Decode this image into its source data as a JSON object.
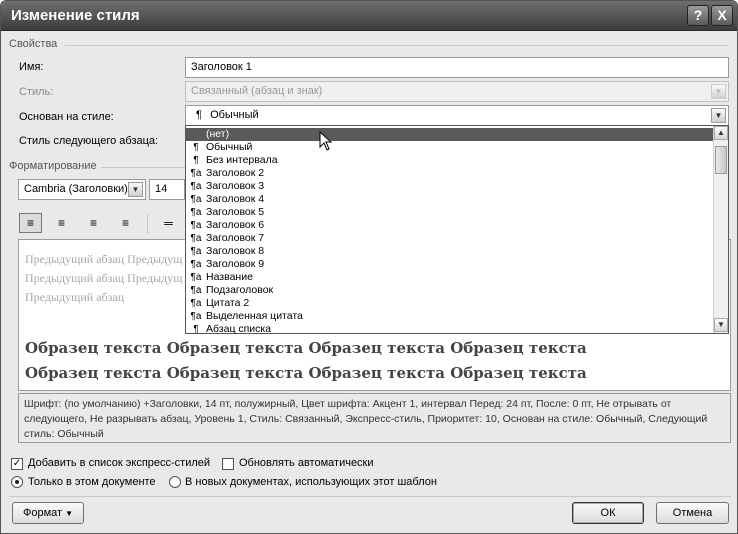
{
  "window": {
    "title": "Изменение стиля",
    "help_label": "?",
    "close_label": "X"
  },
  "properties": {
    "group_label": "Свойства",
    "name_label": "Имя:",
    "name_value": "Заголовок 1",
    "type_label": "Стиль:",
    "type_value": "Связанный (абзац и знак)",
    "based_on_label": "Основан на стиле:",
    "based_on_value": "Обычный",
    "next_style_label": "Стиль следующего абзаца:"
  },
  "dropdown": {
    "items": [
      {
        "glyph": "",
        "label": "(нет)",
        "selected": true
      },
      {
        "glyph": "¶",
        "label": "Обычный"
      },
      {
        "glyph": "¶",
        "label": "Без интервала"
      },
      {
        "glyph": "¶a",
        "label": "Заголовок 2"
      },
      {
        "glyph": "¶a",
        "label": "Заголовок 3"
      },
      {
        "glyph": "¶a",
        "label": "Заголовок 4"
      },
      {
        "glyph": "¶a",
        "label": "Заголовок 5"
      },
      {
        "glyph": "¶a",
        "label": "Заголовок 6"
      },
      {
        "glyph": "¶a",
        "label": "Заголовок 7"
      },
      {
        "glyph": "¶a",
        "label": "Заголовок 8"
      },
      {
        "glyph": "¶a",
        "label": "Заголовок 9"
      },
      {
        "glyph": "¶a",
        "label": "Название"
      },
      {
        "glyph": "¶a",
        "label": "Подзаголовок"
      },
      {
        "glyph": "¶a",
        "label": "Цитата 2"
      },
      {
        "glyph": "¶a",
        "label": "Выделенная цитата"
      },
      {
        "glyph": "¶",
        "label": "Абзац списка"
      }
    ]
  },
  "formatting": {
    "group_label": "Форматирование",
    "font_value": "Cambria (Заголовки)",
    "size_value": "14"
  },
  "preview": {
    "previous_paragraph": [
      "Предыдущий абзац Предыдущ",
      "Предыдущий абзац Предыдущ",
      "Предыдущий абзац"
    ],
    "sample_lines": [
      "Образец текста Образец текста Образец текста Образец текста",
      "Образец текста Образец текста Образец текста Образец текста"
    ]
  },
  "description": "Шрифт: (по умолчанию) +Заголовки, 14 пт, полужирный, Цвет шрифта: Акцент 1, интервал Перед:  24 пт, После:  0 пт, Не отрывать от следующего, Не разрывать абзац, Уровень 1, Стиль: Связанный, Экспресс-стиль, Приоритет: 10, Основан на стиле: Обычный, Следующий стиль: Обычный",
  "options": {
    "add_quick_styles": "Добавить в список экспресс-стилей",
    "auto_update": "Обновлять автоматически",
    "only_this_doc": "Только в этом документе",
    "new_docs": "В новых документах, использующих этот шаблон"
  },
  "buttons": {
    "format": "Формат",
    "ok": "ОК",
    "cancel": "Отмена"
  }
}
